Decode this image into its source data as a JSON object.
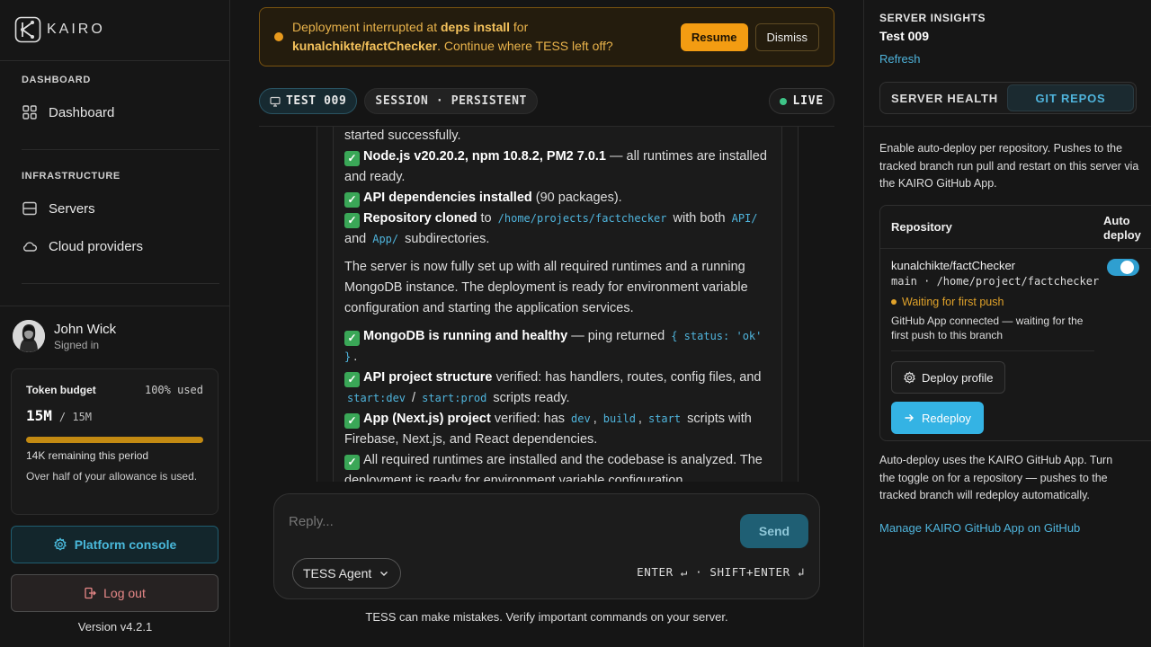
{
  "brand": {
    "name": "KAIRO"
  },
  "sidebar": {
    "sections": [
      {
        "label": "DASHBOARD",
        "items": [
          {
            "label": "Dashboard",
            "icon": "grid-icon"
          }
        ]
      },
      {
        "label": "INFRASTRUCTURE",
        "items": [
          {
            "label": "Servers",
            "icon": "server-icon"
          },
          {
            "label": "Cloud providers",
            "icon": "cloud-icon"
          }
        ]
      }
    ],
    "user": {
      "name": "John Wick",
      "status": "Signed in"
    },
    "token_budget": {
      "title": "Token budget",
      "used_label": "100% used",
      "used_fraction": 1.0,
      "value": "15M",
      "total": "/ 15M",
      "remaining": "14K remaining this period",
      "note": "Over half of your allowance is used.",
      "bar_color": "#c38a12"
    },
    "platform_console": "Platform console",
    "logout": "Log out",
    "version": "Version v4.2.1"
  },
  "banner": {
    "t1": "Deployment interrupted at ",
    "step": "deps install",
    "t2": " for",
    "repo": "kunalchikte/factChecker",
    "t3": ". Continue where TESS left off?",
    "resume": "Resume",
    "dismiss": "Dismiss"
  },
  "session": {
    "name": "TEST 009",
    "mode": "SESSION · PERSISTENT",
    "status": "LIVE"
  },
  "message": {
    "l1": "started successfully.",
    "l2b": "Node.js v20.20.2, npm 10.8.2, PM2 7.0.1",
    "l2": " — all runtimes are installed and ready.",
    "l3b": "API dependencies installed",
    "l3": " (90 packages).",
    "l4b": "Repository cloned",
    "l4a": " to ",
    "l4code": "/home/projects/factchecker",
    "l4c": " with both ",
    "l4code2": "API/",
    "l4d": "and ",
    "l4code3": "App/",
    "l4e": " subdirectories.",
    "p2": "The server is now fully set up with all required runtimes and a running MongoDB instance. The deployment is ready for environment variable configuration and starting the application services.",
    "m1b": "MongoDB is running and healthy",
    "m1": " — ping returned ",
    "m1code": "{ status: 'ok' }",
    "m1e": ".",
    "m2b": "API project structure",
    "m2": " verified: has handlers, routes, config files, and",
    "m2code": "start:dev",
    "m2s": " / ",
    "m2code2": "start:prod",
    "m2e": " scripts ready.",
    "m3b": "App (Next.js) project",
    "m3": " verified: has ",
    "m3c1": "dev",
    "m3c2": "build",
    "m3c3": "start",
    "m3comma": ",",
    "m3e": " scripts with Firebase, Next.js, and React dependencies.",
    "m4": "All required runtimes are installed and the codebase is analyzed. The deployment is ready for environment variable configuration."
  },
  "composer": {
    "placeholder": "Reply...",
    "send": "Send",
    "agent": "TESS Agent",
    "hint": "ENTER ↵ · SHIFT+ENTER ↲"
  },
  "footnote": "TESS can make mistakes. Verify important commands on your server.",
  "insights": {
    "label": "SERVER INSIGHTS",
    "server": "Test 009",
    "refresh": "Refresh",
    "tabs": [
      "SERVER HEALTH",
      "GIT REPOS"
    ],
    "active_tab": 1,
    "description": "Enable auto-deploy per repository. Pushes to the tracked branch run pull and restart on this server via the KAIRO GitHub App.",
    "table": {
      "col_repo": "Repository",
      "col_auto": "Auto deploy",
      "repo": "kunalchikte/factChecker",
      "branch_path": "main · /home/project/factchecker",
      "status": "Waiting for first push",
      "message": "GitHub App connected — waiting for the first push to this branch",
      "auto_deploy": true,
      "deploy_profile": "Deploy profile",
      "redeploy": "Redeploy"
    },
    "footer": "Auto-deploy uses the KAIRO GitHub App. Turn the toggle on for a repository — pushes to the tracked branch will redeploy automatically.",
    "manage": "Manage KAIRO GitHub App on GitHub"
  }
}
